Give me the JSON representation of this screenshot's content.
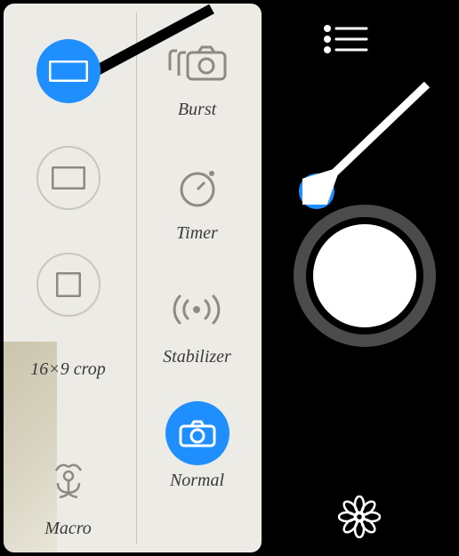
{
  "aspect_options": {
    "crop_label": "16×9 crop"
  },
  "modes": {
    "burst": "Burst",
    "timer": "Timer",
    "stabilizer": "Stabilizer",
    "macro": "Macro",
    "normal": "Normal"
  },
  "colors": {
    "accent": "#1f8fff",
    "panel": "#ecebe6",
    "muted": "#c9c6bd"
  }
}
